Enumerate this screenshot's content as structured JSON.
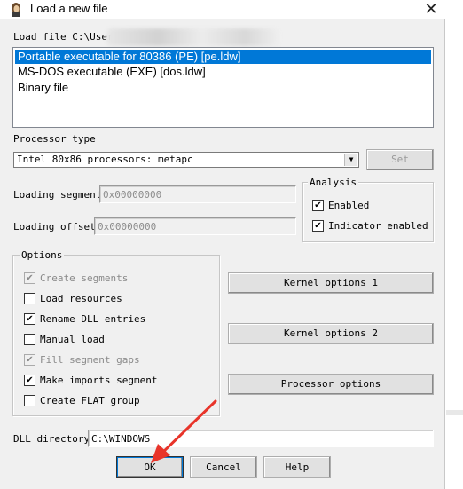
{
  "window": {
    "title": "Load a new file",
    "close_glyph": "✕"
  },
  "load_file": {
    "label": "Load file C:\\User."
  },
  "file_types": [
    "Portable executable for 80386 (PE) [pe.ldw]",
    "MS-DOS executable (EXE) [dos.ldw]",
    "Binary file"
  ],
  "processor": {
    "label": "Processor type",
    "value": "Intel 80x86 processors: metapc",
    "set_button": "Set"
  },
  "loading_segment": {
    "label": "Loading segment",
    "value": "0x00000000"
  },
  "loading_offset": {
    "label": "Loading offset",
    "value": "0x00000000"
  },
  "analysis": {
    "legend": "Analysis",
    "items": [
      {
        "label": "Enabled",
        "checked": true
      },
      {
        "label": "Indicator enabled",
        "checked": true
      }
    ]
  },
  "options": {
    "legend": "Options",
    "items": [
      {
        "label": "Create segments",
        "checked": true,
        "disabled": true
      },
      {
        "label": "Load resources",
        "checked": false,
        "disabled": false
      },
      {
        "label": "Rename DLL entries",
        "checked": true,
        "disabled": false
      },
      {
        "label": "Manual load",
        "checked": false,
        "disabled": false
      },
      {
        "label": "Fill segment gaps",
        "checked": true,
        "disabled": true
      },
      {
        "label": "Make imports segment",
        "checked": true,
        "disabled": false
      },
      {
        "label": "Create FLAT group",
        "checked": false,
        "disabled": false
      }
    ]
  },
  "side_buttons": {
    "kernel1": "Kernel options 1",
    "kernel2": "Kernel options 2",
    "processor": "Processor options"
  },
  "dll_directory": {
    "label": "DLL directory",
    "value": "C:\\WINDOWS"
  },
  "footer": {
    "ok": "OK",
    "cancel": "Cancel",
    "help": "Help"
  },
  "annotation": {
    "arrow_color": "#e8342a"
  },
  "check_glyph": "✔"
}
